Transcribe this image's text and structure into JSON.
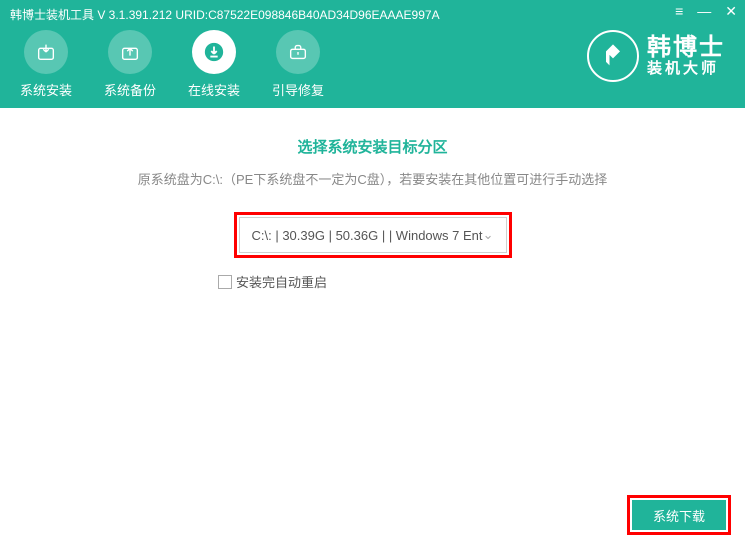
{
  "titlebar": "韩博士装机工具 V 3.1.391.212 URID:C87522E098846B40AD34D96EAAAE997A",
  "nav": {
    "install": "系统安装",
    "backup": "系统备份",
    "online": "在线安装",
    "boot": "引导修复"
  },
  "logo": {
    "line1": "韩博士",
    "line2": "装机大师"
  },
  "content": {
    "section_title": "选择系统安装目标分区",
    "hint": "原系统盘为C:\\:（PE下系统盘不一定为C盘），若要安装在其他位置可进行手动选择",
    "dropdown_value": "C:\\: | 30.39G | 50.36G |  | Windows 7 Ent",
    "checkbox_label": "安装完自动重启"
  },
  "footer": {
    "download_btn": "系统下载"
  }
}
